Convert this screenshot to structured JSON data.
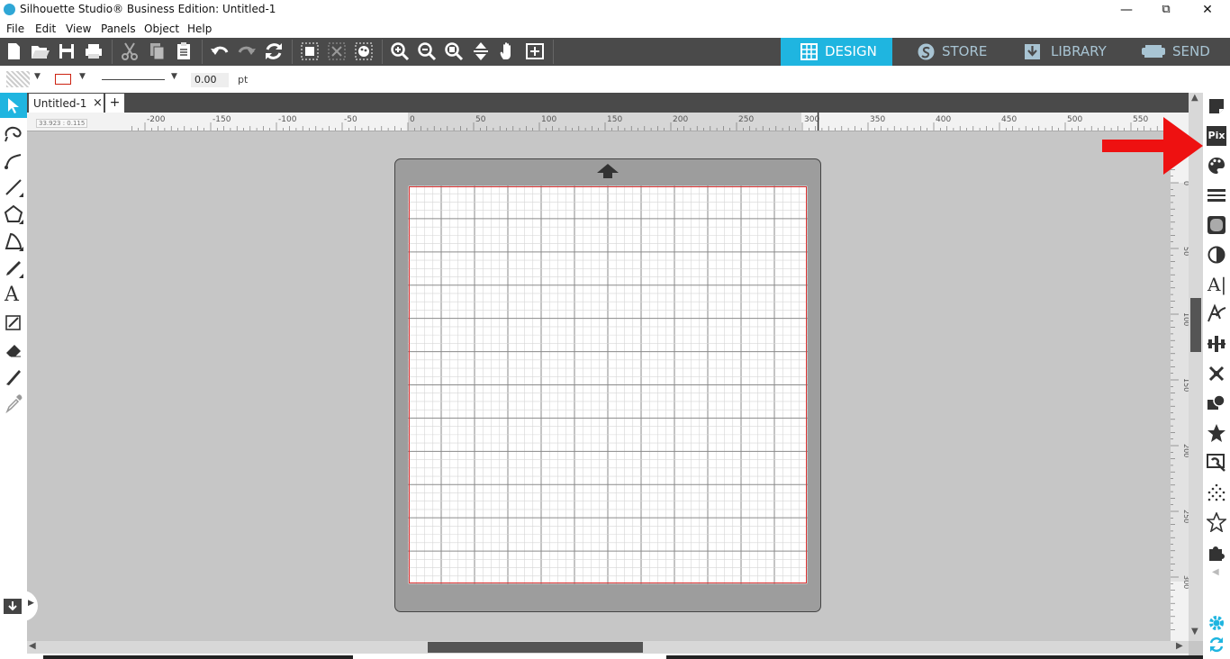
{
  "window": {
    "title": "Silhouette Studio® Business Edition: Untitled-1",
    "minimize": "—",
    "maximize": "⧉",
    "close": "✕"
  },
  "menu": [
    "File",
    "Edit",
    "View",
    "Panels",
    "Object",
    "Help"
  ],
  "nav_tabs": [
    {
      "label": "DESIGN",
      "icon": "grid-icon",
      "active": true
    },
    {
      "label": "STORE",
      "icon": "silhouette-s-icon",
      "active": false
    },
    {
      "label": "LIBRARY",
      "icon": "download-box-icon",
      "active": false
    },
    {
      "label": "SEND",
      "icon": "cutter-icon",
      "active": false
    }
  ],
  "properties": {
    "line_width": "0.00",
    "unit": "pt"
  },
  "doc_tabs": [
    {
      "label": "Untitled-1",
      "close": "×"
    }
  ],
  "new_tab": "+",
  "ruler": {
    "coords": "33.923 : 0.115",
    "h_ticks": [
      "-200",
      "-150",
      "-100",
      "-50",
      "0",
      "50",
      "100",
      "150",
      "200",
      "250",
      "300",
      "350",
      "400",
      "450",
      "500",
      "550"
    ],
    "v_ticks": [
      "0",
      "50",
      "100",
      "150",
      "200",
      "250",
      "300"
    ]
  },
  "colors": {
    "accent": "#1fb5e0",
    "toolbar_bg": "#4a4a4a",
    "canvas_bg": "#c6c6c6",
    "mat": "#9d9d9d",
    "arrow": "#ee1111"
  },
  "right_panel_icons": [
    "page-setup-icon",
    "pixscan-icon",
    "fill-palette-icon",
    "line-style-icon",
    "rhinestone-icon",
    "shadow-icon",
    "text-icon",
    "text-path-icon",
    "align-icon",
    "replicate-icon",
    "modify-icon",
    "offset-star-icon",
    "trace-icon",
    "sketch-dots-icon",
    "star-outline-icon",
    "puzzle-icon"
  ],
  "right_panel_labels": {
    "pixscan": "Pix"
  }
}
